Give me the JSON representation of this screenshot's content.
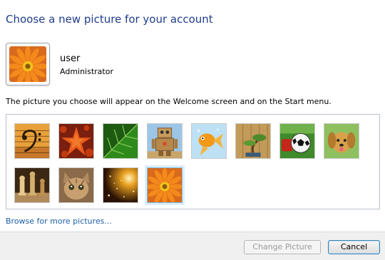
{
  "page": {
    "title": "Choose a new picture for your account",
    "description": "The picture you choose will appear on the Welcome screen and on the Start menu.",
    "browse_link": "Browse for more pictures..."
  },
  "user": {
    "name": "user",
    "role": "Administrator",
    "picture_icon": "orange-flower-icon"
  },
  "pictures": [
    {
      "icon": "bass-clef-icon",
      "selected": false
    },
    {
      "icon": "starfish-icon",
      "selected": false
    },
    {
      "icon": "green-leaf-icon",
      "selected": false
    },
    {
      "icon": "robot-icon",
      "selected": false
    },
    {
      "icon": "goldfish-icon",
      "selected": false
    },
    {
      "icon": "bonsai-icon",
      "selected": false
    },
    {
      "icon": "soccer-ball-icon",
      "selected": false
    },
    {
      "icon": "puppy-icon",
      "selected": false
    },
    {
      "icon": "chess-pieces-icon",
      "selected": false
    },
    {
      "icon": "kitten-icon",
      "selected": false
    },
    {
      "icon": "sparkles-icon",
      "selected": false
    },
    {
      "icon": "orange-flower-icon",
      "selected": true
    }
  ],
  "buttons": {
    "change_picture": "Change Picture",
    "cancel": "Cancel"
  },
  "colors": {
    "title": "#1e3d8c",
    "link": "#1e5fa8",
    "selection_glow": "#ddeefb",
    "selection_border": "#7cc0e8"
  }
}
